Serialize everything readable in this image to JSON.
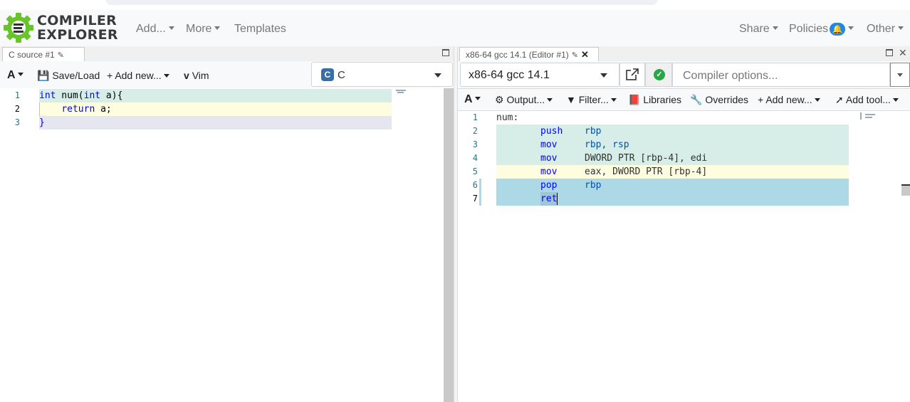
{
  "brand": {
    "line1": "COMPILER",
    "line2": "EXPLORER",
    "logo_icon": "compiler-explorer-gear-logo"
  },
  "nav": {
    "add": "Add...",
    "more": "More",
    "templates": "Templates",
    "share": "Share",
    "policies": "Policies",
    "policies_badge_icon": "bell-icon",
    "other": "Other"
  },
  "source_pane": {
    "tab_title": "C source #1",
    "toolbar": {
      "font_icon": "A",
      "save_load": "Save/Load",
      "add_new": "Add new...",
      "vim": "Vim"
    },
    "language": "C",
    "lines": [
      {
        "num": "1",
        "tokens": [
          [
            "kw",
            "int"
          ],
          [
            "plain",
            " num("
          ],
          [
            "kw",
            "int"
          ],
          [
            "plain",
            " a){"
          ]
        ],
        "bg": "#d7ede8"
      },
      {
        "num": "2",
        "tokens": [
          [
            "plain",
            "    "
          ],
          [
            "kw",
            "return"
          ],
          [
            "plain",
            " a;"
          ]
        ],
        "bg": "#fffde0"
      },
      {
        "num": "3",
        "tokens": [
          [
            "blue",
            "}"
          ]
        ],
        "bg": "#e6e6f0"
      }
    ]
  },
  "compiler_pane": {
    "tab_title": "x86-64 gcc 14.1 (Editor #1)",
    "compiler_name": "x86-64 gcc 14.1",
    "options_placeholder": "Compiler options...",
    "toolbar": {
      "font_icon": "A",
      "output": "Output...",
      "filter": "Filter...",
      "libraries": "Libraries",
      "overrides": "Overrides",
      "add_new": "Add new...",
      "add_tool": "Add tool..."
    },
    "lines": [
      {
        "num": "1",
        "label": "num:",
        "op": "",
        "args": "",
        "bg": ""
      },
      {
        "num": "2",
        "label": "",
        "op": "push",
        "args": "rbp",
        "bg": "#d7ede8"
      },
      {
        "num": "3",
        "label": "",
        "op": "mov",
        "args": "rbp, rsp",
        "bg": "#d7ede8"
      },
      {
        "num": "4",
        "label": "",
        "op": "mov",
        "args": "DWORD PTR [rbp-4], edi",
        "bg": "#d7ede8"
      },
      {
        "num": "5",
        "label": "",
        "op": "mov",
        "args": "eax, DWORD PTR [rbp-4]",
        "bg": "#fffde0"
      },
      {
        "num": "6",
        "label": "",
        "op": "pop",
        "args": "rbp",
        "bg": "#add8e6"
      },
      {
        "num": "7",
        "label": "",
        "op": "ret",
        "args": "",
        "bg": "#add8e6"
      }
    ]
  },
  "colors": {
    "brand_green": "#67c52a",
    "badge_blue": "#1e88e5",
    "success_green": "#28a745",
    "c_logo_blue": "#3a6ea5"
  }
}
